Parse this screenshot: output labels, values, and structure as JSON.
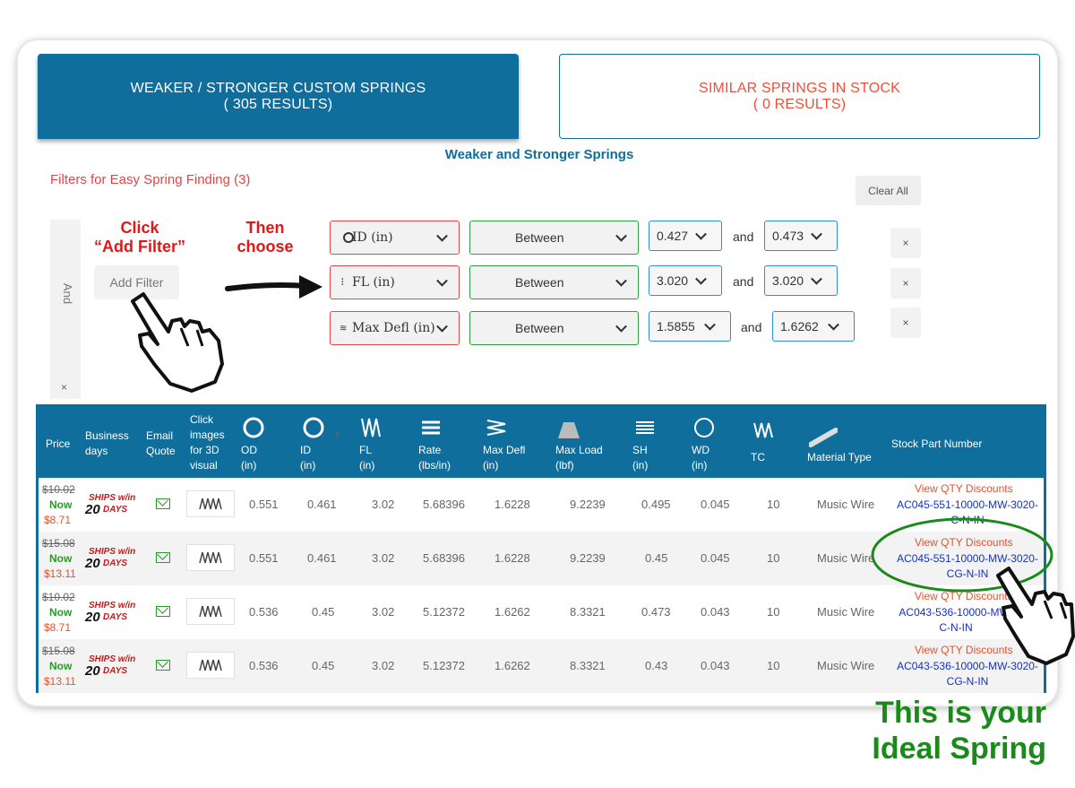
{
  "tabs": {
    "active_line1": "WEAKER / STRONGER CUSTOM SPRINGS",
    "active_line2": "( 305 RESULTS)",
    "inactive_line1": "SIMILAR SPRINGS IN STOCK",
    "inactive_line2": "( 0 RESULTS)"
  },
  "section_title": "Weaker and Stronger Springs",
  "filters": {
    "title": "Filters for Easy Spring Finding (3)",
    "clear_all": "Clear All",
    "and_label": "And",
    "and_remove": "×",
    "add_filter": "Add Filter",
    "and_word": "and",
    "remove": "×",
    "rows": [
      {
        "field": "ID (in)",
        "op": "Between",
        "min": "0.427",
        "max": "0.473"
      },
      {
        "field": "FL (in)",
        "op": "Between",
        "min": "3.020",
        "max": "3.020"
      },
      {
        "field": "Max Defl (in)",
        "op": "Between",
        "min": "1.5855",
        "max": "1.6262"
      }
    ]
  },
  "annotations": {
    "click_line1": "Click",
    "click_line2": "“Add Filter”",
    "then_line1": "Then",
    "then_line2": "choose",
    "callout_line1": "This is your",
    "callout_line2": "Ideal Spring"
  },
  "table": {
    "headers": {
      "price": "Price",
      "business_days_1": "Business",
      "business_days_2": "days",
      "email_1": "Email",
      "email_2": "Quote",
      "click_1": "Click",
      "click_2": "images",
      "click_3": "for 3D",
      "click_4": "visual",
      "od_1": "OD",
      "od_2": "(in)",
      "id_1": "ID",
      "id_2": "(in)",
      "fl_1": "FL",
      "fl_2": "(in)",
      "rate_1": "Rate",
      "rate_2": "(lbs/in)",
      "maxdefl_1": "Max Defl",
      "maxdefl_2": "(in)",
      "maxload_1": "Max Load",
      "maxload_2": "(lbf)",
      "sh_1": "SH",
      "sh_2": "(in)",
      "wd_1": "WD",
      "wd_2": "(in)",
      "tc": "TC",
      "material": "Material Type",
      "stock": "Stock Part Number"
    },
    "ships_text": {
      "top": "SHIPS w/in",
      "num": "20",
      "days": "DAYS"
    },
    "now_label": "Now",
    "qty_label": "View QTY Discounts",
    "rows": [
      {
        "old": "$10.02",
        "new": "$8.71",
        "od": "0.551",
        "id": "0.461",
        "fl": "3.02",
        "rate": "5.68396",
        "maxdefl": "1.6228",
        "maxload": "9.2239",
        "sh": "0.495",
        "wd": "0.045",
        "tc": "10",
        "material": "Music Wire",
        "pn1": "AC045-551-10000-MW-3020-",
        "pn2": "C-N-IN"
      },
      {
        "old": "$15.08",
        "new": "$13.11",
        "od": "0.551",
        "id": "0.461",
        "fl": "3.02",
        "rate": "5.68396",
        "maxdefl": "1.6228",
        "maxload": "9.2239",
        "sh": "0.45",
        "wd": "0.045",
        "tc": "10",
        "material": "Music Wire",
        "pn1": "AC045-551-10000-MW-3020-",
        "pn2": "CG-N-IN"
      },
      {
        "old": "$10.02",
        "new": "$8.71",
        "od": "0.536",
        "id": "0.45",
        "fl": "3.02",
        "rate": "5.12372",
        "maxdefl": "1.6262",
        "maxload": "8.3321",
        "sh": "0.473",
        "wd": "0.043",
        "tc": "10",
        "material": "Music Wire",
        "pn1": "AC043-536-10000-MW-",
        "pn2": "C-N-IN"
      },
      {
        "old": "$15.08",
        "new": "$13.11",
        "od": "0.536",
        "id": "0.45",
        "fl": "3.02",
        "rate": "5.12372",
        "maxdefl": "1.6262",
        "maxload": "8.3321",
        "sh": "0.43",
        "wd": "0.043",
        "tc": "10",
        "material": "Music Wire",
        "pn1": "AC043-536-10000-MW-3020-",
        "pn2": "CG-N-IN"
      }
    ]
  },
  "colors": {
    "brand_blue": "#0f6e9b",
    "accent_red": "#f0503a",
    "callout_green": "#1a8a1a"
  }
}
